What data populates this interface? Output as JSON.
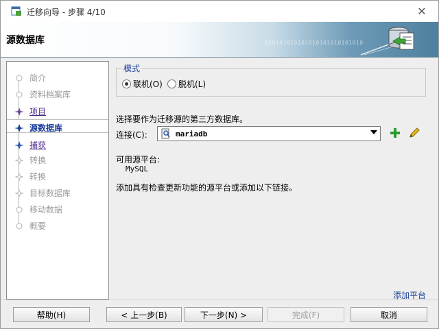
{
  "window": {
    "title": "迁移向导 - 步骤 4/10"
  },
  "banner": {
    "title": "源数据库",
    "binary_text": "010101010101010101010101010"
  },
  "steps": [
    {
      "label": "简介",
      "state": "disabled"
    },
    {
      "label": "资料档案库",
      "state": "disabled"
    },
    {
      "label": "项目",
      "state": "link"
    },
    {
      "label": "源数据库",
      "state": "current"
    },
    {
      "label": "捕获",
      "state": "link"
    },
    {
      "label": "转换",
      "state": "disabled"
    },
    {
      "label": "转换",
      "state": "disabled"
    },
    {
      "label": "目标数据库",
      "state": "disabled"
    },
    {
      "label": "移动数据",
      "state": "disabled"
    },
    {
      "label": "概要",
      "state": "disabled"
    }
  ],
  "mode": {
    "legend": "模式",
    "online": {
      "label": "联机(O)",
      "selected": true
    },
    "offline": {
      "label": "脱机(L)",
      "selected": false
    }
  },
  "prompt": "选择要作为迁移源的第三方数据库。",
  "connection": {
    "label": "连接(C):",
    "value": "mariadb"
  },
  "available": {
    "label": "可用源平台:",
    "value": "MySQL"
  },
  "info": "添加具有检查更新功能的源平台或添加以下链接。",
  "add_platform": "添加平台",
  "buttons": {
    "help": "帮助(H)",
    "back": "< 上一步(B)",
    "next": "下一步(N) >",
    "finish": "完成(F)",
    "cancel": "取消"
  },
  "colors": {
    "accent": "#1b3f9b",
    "link": "#4b2a8a",
    "add_green": "#2d9a2d"
  }
}
